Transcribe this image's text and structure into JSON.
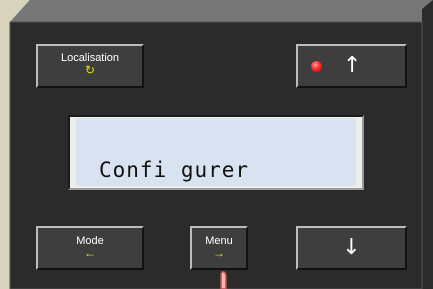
{
  "colors": {
    "background": "#d8d3bd",
    "panel": "#2b2b2b",
    "button": "#3e3e3e",
    "screen": "#d9e2f1",
    "accent_yellow": "#e8e000",
    "led_red": "#ff2a2a"
  },
  "buttons": {
    "localisation": {
      "label": "Localisation",
      "icon": "refresh-icon",
      "glyph": "↻"
    },
    "up": {
      "icon": "arrow-up-icon",
      "glyph": "↑",
      "led": "red-led-icon"
    },
    "mode": {
      "label": "Mode",
      "icon": "arrow-left-icon",
      "glyph": "←"
    },
    "menu": {
      "label": "Menu",
      "icon": "arrow-right-icon",
      "glyph": "→"
    },
    "down": {
      "icon": "arrow-down-icon",
      "glyph": "↓"
    }
  },
  "display": {
    "text": "Confi gurer"
  },
  "cursor": {
    "icon": "hand-pointer-icon"
  }
}
